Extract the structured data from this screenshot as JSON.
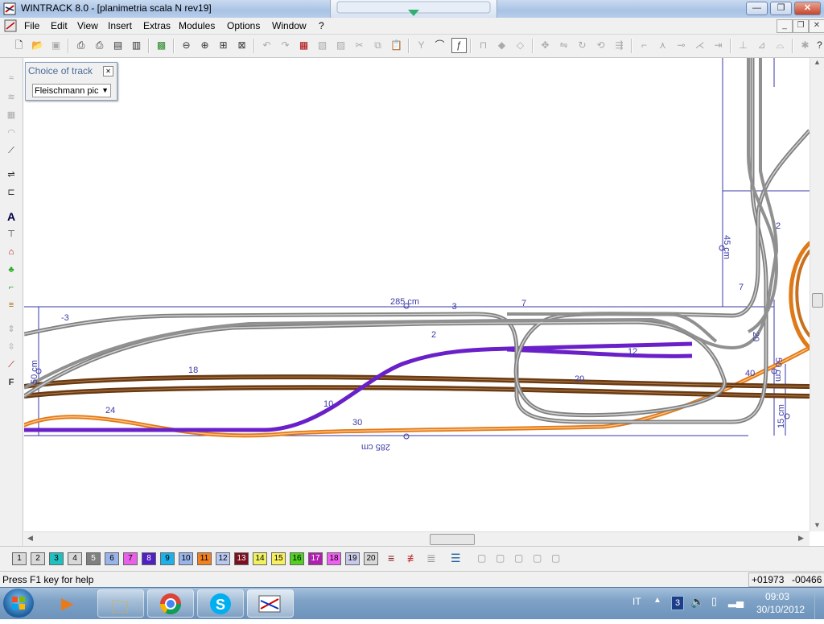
{
  "window": {
    "title": "WINTRACK 8.0 - [planimetria scala N rev19]",
    "buttons": {
      "minimize": "—",
      "maximize": "❐",
      "close": "✕"
    }
  },
  "menu": {
    "items": [
      "File",
      "Edit",
      "View",
      "Insert",
      "Extras",
      "Modules",
      "Options",
      "Window",
      "?"
    ],
    "mdi_buttons": {
      "minimize": "_",
      "restore": "❐",
      "close": "✕"
    }
  },
  "panel": {
    "title": "Choice of track",
    "close_label": "✕",
    "selected": "Fleischmann pic"
  },
  "layers": [
    "1",
    "2",
    "3",
    "4",
    "5",
    "6",
    "7",
    "8",
    "9",
    "10",
    "11",
    "12",
    "13",
    "14",
    "15",
    "16",
    "17",
    "18",
    "19",
    "20"
  ],
  "layer_colors": [
    "#d8d8d8",
    "#d8d8d8",
    "#20c0c0",
    "#d8d8d8",
    "#808080",
    "#9ab4e8",
    "#e860e8",
    "#5020c0",
    "#20b0e8",
    "#9ab4e8",
    "#f08020",
    "#b8c8f0",
    "#7a1020",
    "#f0f060",
    "#f8f060",
    "#50d020",
    "#b020b0",
    "#f060f0",
    "#c8c8e8",
    "#d8d8d8"
  ],
  "status": {
    "help": "Press F1 key for help",
    "x": "+01973",
    "y": "-00466"
  },
  "taskbar": {
    "lang": "IT",
    "badge": "3",
    "time": "09:03",
    "date": "30/10/2012"
  },
  "canvas": {
    "dim_top": "285 cm",
    "dim_bottom": "285 cm",
    "dim_left": "50 cm",
    "dim_right_top": "45 cm",
    "dim_right": "50 cm",
    "dim_right_bottom": "15 cm",
    "labels": [
      "-3",
      "-3",
      "7",
      "2",
      "12",
      "18",
      "20",
      "40",
      "24",
      "10",
      "30",
      "2",
      "7",
      "20"
    ]
  }
}
